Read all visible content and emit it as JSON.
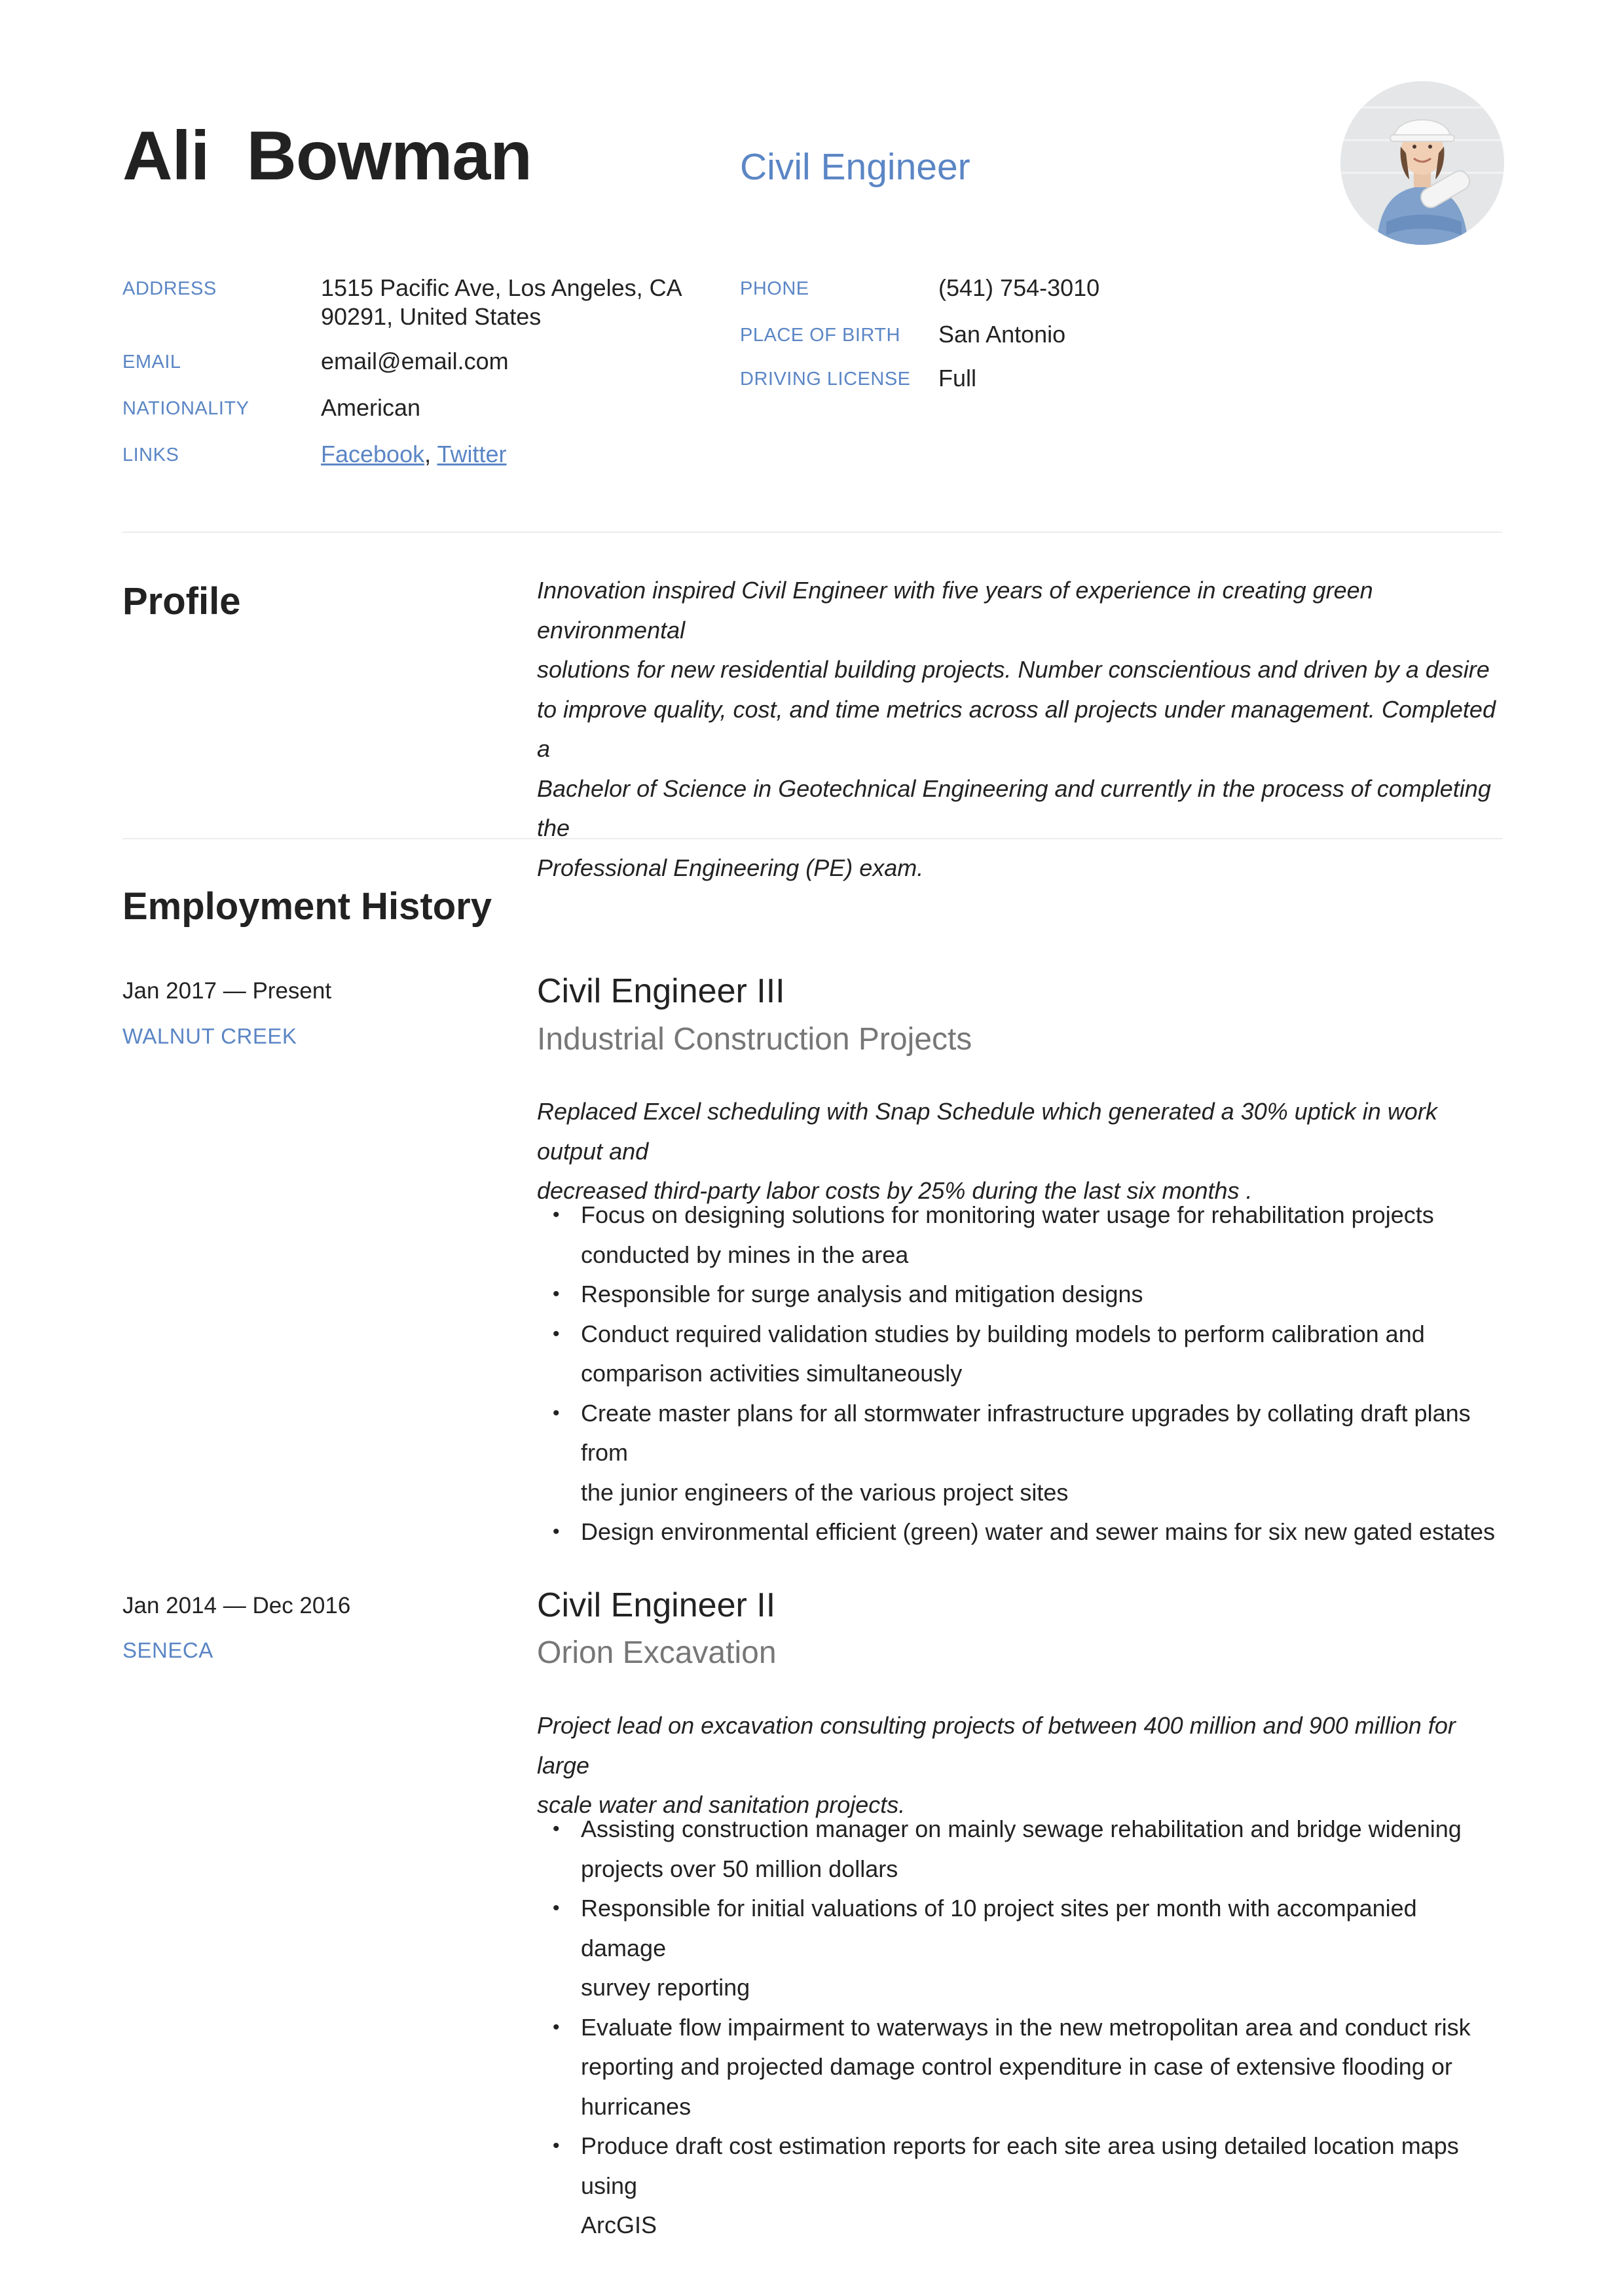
{
  "header": {
    "first_name": "Ali",
    "last_name": "Bowman",
    "job_title": "Civil Engineer"
  },
  "details_left": [
    {
      "label": "ADDRESS",
      "value_line1": "1515 Pacific Ave, Los Angeles, CA",
      "value_line2": "90291, United States"
    },
    {
      "label": "EMAIL",
      "value": "email@email.com"
    },
    {
      "label": "NATIONALITY",
      "value": "American"
    },
    {
      "label": "LINKS",
      "link1": "Facebook",
      "separator": ",",
      "link2": "Twitter"
    }
  ],
  "details_right": [
    {
      "label": "PHONE",
      "value": "(541) 754-3010"
    },
    {
      "label": "PLACE OF BIRTH",
      "value": "San Antonio"
    },
    {
      "label": "DRIVING LICENSE",
      "value": "Full"
    }
  ],
  "profile": {
    "heading": "Profile",
    "lines": [
      "Innovation inspired Civil Engineer with five years of experience in creating green environmental",
      "solutions for new residential building projects. Number conscientious and driven by a desire",
      "to improve quality, cost, and time metrics across all projects under management. Completed a",
      "Bachelor of Science in Geotechnical Engineering and currently in the process of completing the",
      "Professional Engineering (PE) exam."
    ]
  },
  "employment": {
    "heading": "Employment History",
    "jobs": [
      {
        "dates": "Jan 2017 — Present",
        "city": "WALNUT CREEK",
        "title": "Civil Engineer III",
        "company": "Industrial Construction Projects",
        "summary": [
          "Replaced Excel scheduling with Snap Schedule which generated a 30% uptick in work output and",
          "decreased third-party labor costs by 25% during the last six months ."
        ],
        "bullets": [
          [
            "Focus on designing solutions for monitoring water usage for rehabilitation projects",
            "conducted by mines in the area"
          ],
          [
            "Responsible for surge analysis and mitigation designs"
          ],
          [
            "Conduct required validation studies by building models to perform calibration and",
            "comparison activities simultaneously"
          ],
          [
            "Create master plans for all stormwater infrastructure upgrades by collating draft plans from",
            "the junior engineers of the various project sites"
          ],
          [
            "Design environmental efficient (green) water and sewer mains for six new gated estates"
          ]
        ]
      },
      {
        "dates": "Jan 2014 — Dec 2016",
        "city": "SENECA",
        "title": "Civil Engineer II",
        "company": "Orion Excavation",
        "summary": [
          "Project lead on excavation consulting projects of between 400 million and 900 million for large",
          "scale water and sanitation projects."
        ],
        "bullets": [
          [
            "Assisting construction manager on mainly sewage rehabilitation and bridge widening",
            "projects over 50 million dollars"
          ],
          [
            "Responsible for initial valuations of 10 project sites per month with accompanied damage",
            "survey reporting"
          ],
          [
            "Evaluate flow impairment to waterways in the new metropolitan area and conduct risk",
            "reporting and projected damage control expenditure in case of extensive flooding or",
            "hurricanes"
          ],
          [
            "Produce draft cost estimation reports for each site area using detailed location maps using",
            "ArcGIS"
          ]
        ]
      }
    ]
  }
}
